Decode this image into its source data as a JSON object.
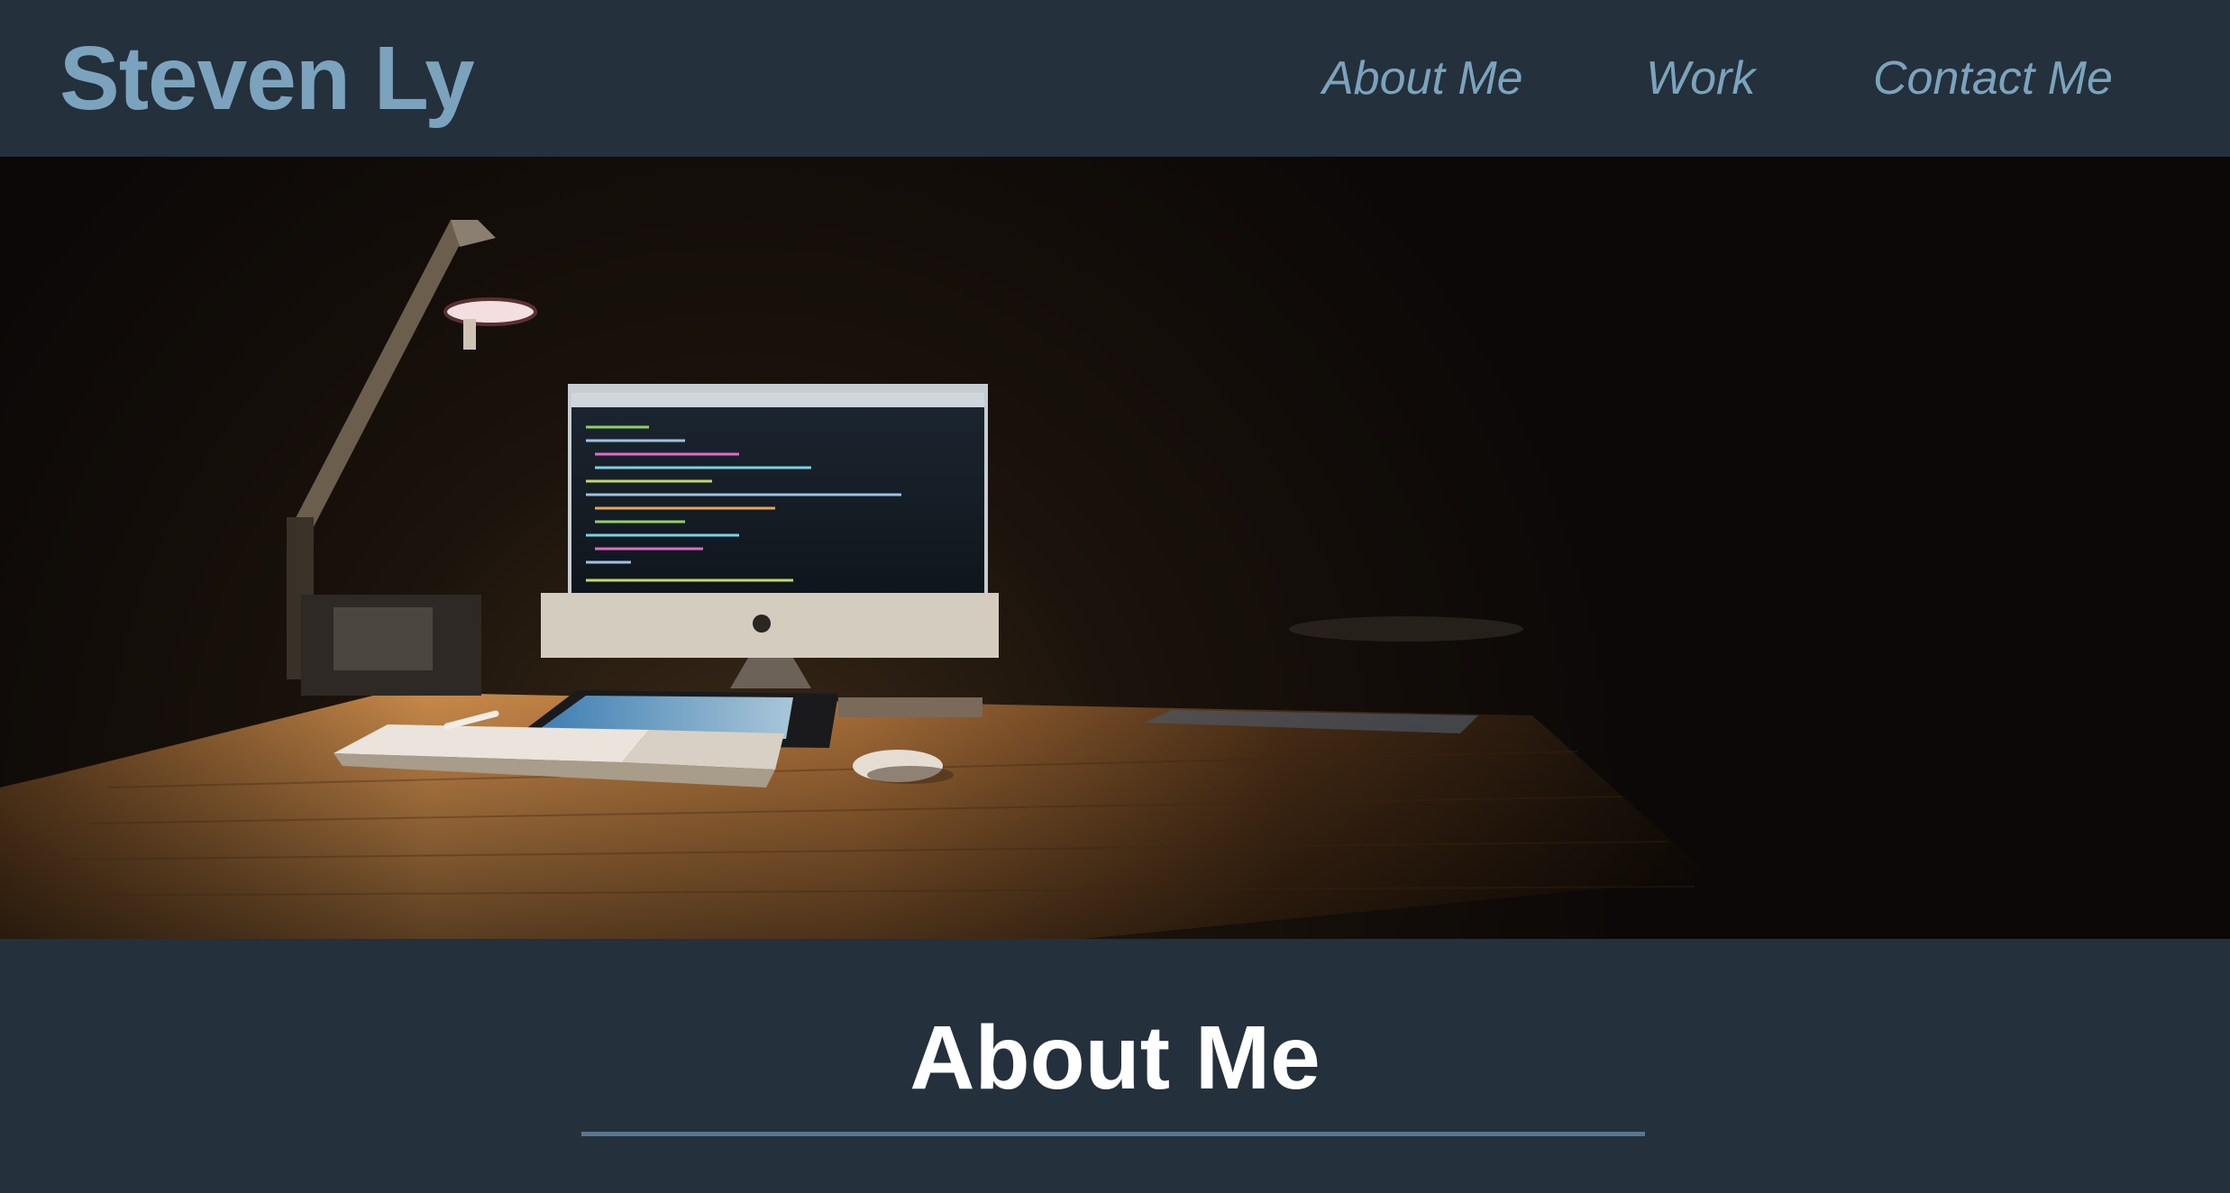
{
  "header": {
    "brand": "Steven Ly",
    "nav": [
      {
        "label": "About Me"
      },
      {
        "label": "Work"
      },
      {
        "label": "Contact Me"
      }
    ]
  },
  "hero": {
    "image": "desk-with-computer-at-night"
  },
  "about": {
    "title": "About Me"
  },
  "colors": {
    "header_bg": "#24303b",
    "accent": "#7ba3bd",
    "divider": "#5a7691",
    "heading_text": "#ffffff"
  }
}
